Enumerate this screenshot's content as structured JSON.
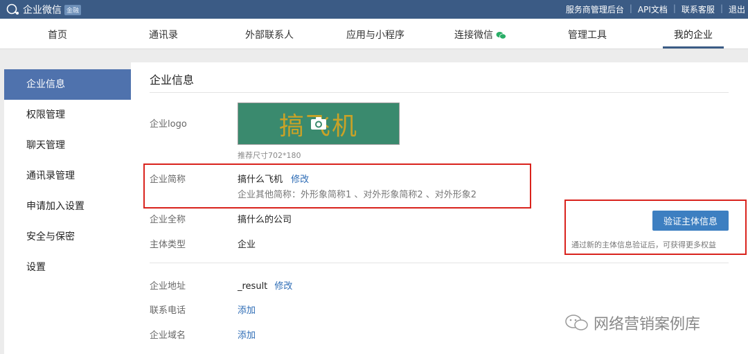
{
  "topbar": {
    "app_title": "企业微信",
    "badge": "金融",
    "links": [
      "服务商管理后台",
      "API文档",
      "联系客服",
      "退出"
    ]
  },
  "nav": {
    "items": [
      "首页",
      "通讯录",
      "外部联系人",
      "应用与小程序",
      "连接微信",
      "管理工具",
      "我的企业"
    ],
    "active": "我的企业"
  },
  "sidebar": {
    "items": [
      "企业信息",
      "权限管理",
      "聊天管理",
      "通讯录管理",
      "申请加入设置",
      "安全与保密",
      "设置"
    ],
    "active": "企业信息"
  },
  "main": {
    "title": "企业信息",
    "logo": {
      "label": "企业logo",
      "image_text": "搞飞机",
      "hint": "推荐尺寸702*180"
    },
    "short_name": {
      "label": "企业简称",
      "value": "搞什么飞机",
      "edit": "修改",
      "others": "企业其他简称：外形象简称1 、对外形象简称2 、对外形象2"
    },
    "full_name": {
      "label": "企业全称",
      "value": "搞什么的公司"
    },
    "entity_type": {
      "label": "主体类型",
      "value": "企业"
    },
    "verify": {
      "button": "验证主体信息",
      "hint": "通过新的主体信息验证后，可获得更多权益"
    },
    "address": {
      "label": "企业地址",
      "value": "_result",
      "edit": "修改"
    },
    "phone": {
      "label": "联系电话",
      "action": "添加"
    },
    "domain": {
      "label": "企业域名",
      "action": "添加"
    }
  },
  "watermark": {
    "text": "网络营销案例库"
  },
  "colors": {
    "topbar": "#3b5b85",
    "accent": "#4f72ad",
    "button": "#3d7fc1",
    "link": "#2c6bb5",
    "highlight": "#d9221c"
  }
}
